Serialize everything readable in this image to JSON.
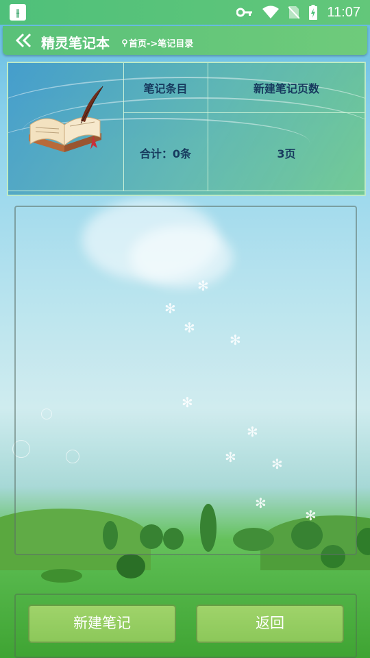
{
  "status_bar": {
    "app_icon_glyph": "ꟷ╫",
    "time": "11:07",
    "icons": [
      "key-icon",
      "wifi-icon",
      "no-sim-icon",
      "battery-icon"
    ]
  },
  "header": {
    "title": "精灵笔记本",
    "breadcrumb": "首页->笔记目录"
  },
  "info_table": {
    "col1_header": "笔记条目",
    "col2_header": "新建笔记页数",
    "col1_value": "合计：0条",
    "col2_value": "3页"
  },
  "buttons": {
    "new_note": "新建笔记",
    "back": "返回"
  },
  "colors": {
    "header": "#59c179",
    "button": "#9fd36a",
    "table_text": "#173a5e"
  }
}
